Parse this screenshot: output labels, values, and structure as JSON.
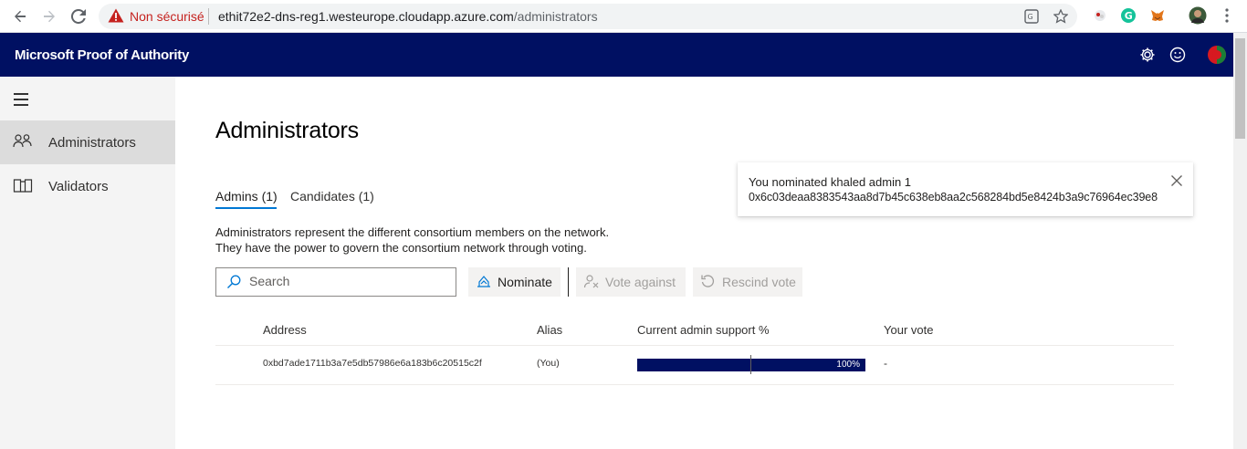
{
  "browser": {
    "security_label": "Non sécurisé",
    "url_host": "ethit72e2-dns-reg1.westeurope.cloudapp.azure.com",
    "url_path": "/administrators"
  },
  "app": {
    "title": "Microsoft Proof of Authority"
  },
  "sidebar": {
    "items": [
      {
        "label": "Administrators",
        "icon": "people-icon",
        "active": true
      },
      {
        "label": "Validators",
        "icon": "book-icon",
        "active": false
      }
    ]
  },
  "main": {
    "title": "Administrators",
    "tabs": [
      {
        "label": "Admins (1)",
        "active": true
      },
      {
        "label": "Candidates (1)",
        "active": false
      }
    ],
    "description_line1": "Administrators represent the different consortium members on the network.",
    "description_line2": "They have the power to govern the consortium network through voting.",
    "search_placeholder": "Search",
    "commands": {
      "nominate": "Nominate",
      "vote_against": "Vote against",
      "rescind_vote": "Rescind vote"
    },
    "table": {
      "columns": [
        "Address",
        "Alias",
        "Current admin support %",
        "Your vote"
      ],
      "rows": [
        {
          "address": "0xbd7ade1711b3a7e5db57986e6a183b6c20515c2f",
          "alias": "(You)",
          "support_percent": 100,
          "support_label": "100%",
          "vote": "-"
        }
      ]
    }
  },
  "toast": {
    "line1": "You nominated khaled admin 1",
    "line2": "0x6c03deaa8383543aa8d7b45c638eb8aa2c568284bd5e8424b3a9c76964ec39e8"
  },
  "colors": {
    "header_bg": "#001062",
    "accent": "#0078d4",
    "bar_fill": "#001062"
  }
}
